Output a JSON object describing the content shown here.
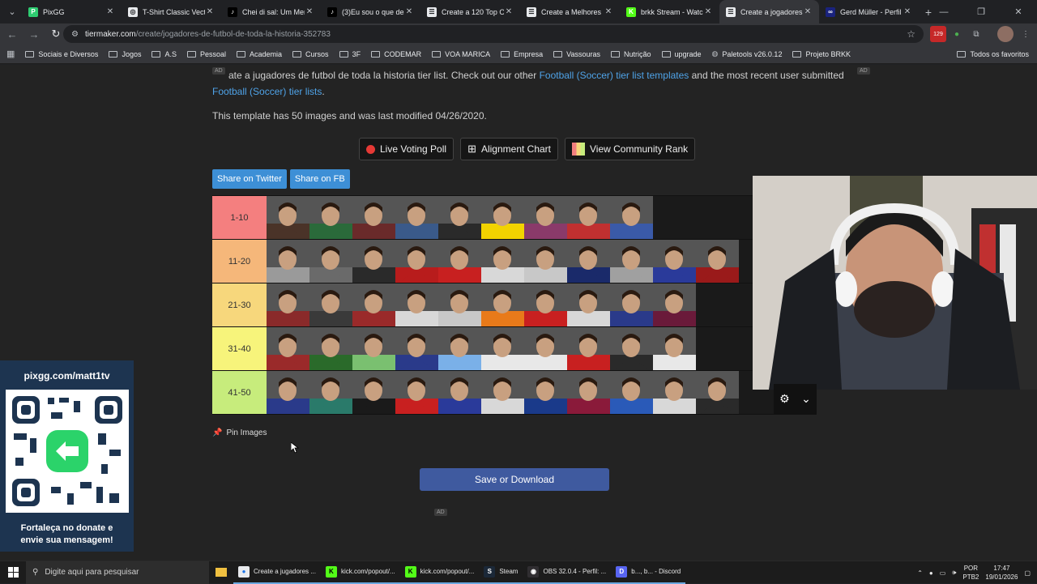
{
  "browser": {
    "tabs": [
      {
        "title": "PixGG",
        "fav_color": "#2ecc71",
        "fav_glyph": "P",
        "active": false
      },
      {
        "title": "T-Shirt Classic Vectra",
        "fav_color": "#e8eaed",
        "fav_glyph": "◎",
        "active": false
      },
      {
        "title": "Chei di sal: Um Meme",
        "fav_color": "#000000",
        "fav_glyph": "♪",
        "active": false
      },
      {
        "title": "(3)Eu sou o que desm",
        "fav_color": "#000000",
        "fav_glyph": "♪",
        "active": false
      },
      {
        "title": "Create a 120 Top On",
        "fav_color": "#e8eaed",
        "fav_glyph": "☰",
        "active": false
      },
      {
        "title": "Create a Melhores lu",
        "fav_color": "#e8eaed",
        "fav_glyph": "☰",
        "active": false
      },
      {
        "title": "brkk Stream - Watch",
        "fav_color": "#53fc18",
        "fav_glyph": "K",
        "active": false
      },
      {
        "title": "Create a jogadores d",
        "fav_color": "#e8eaed",
        "fav_glyph": "☰",
        "active": true
      },
      {
        "title": "Gerd Müller - Perfil d",
        "fav_color": "#1a237e",
        "fav_glyph": "∞",
        "active": false
      }
    ],
    "url_domain": "tiermaker.com",
    "url_path": "/create/jogadores-de-futbol-de-toda-la-historia-352783",
    "ext_badge": "129",
    "bookmarks": [
      "Sociais e Diversos",
      "Jogos",
      "A.S",
      "Pessoal",
      "Academia",
      "Cursos",
      "3F",
      "CODEMAR",
      "VOA MARICA",
      "Empresa",
      "Vassouras",
      "Nutrição",
      "upgrade",
      "Paletools v26.0.12",
      "Projeto BRKK"
    ],
    "bookmarks_all": "Todos os favoritos"
  },
  "page": {
    "ad_label": "AD",
    "intro_prefix": "ate a jugadores de futbol de toda la historia tier list. Check out our other ",
    "intro_link1": "Football (Soccer) tier list templates",
    "intro_mid": " and the most recent user submitted ",
    "intro_link2": "Football (Soccer) tier lists",
    "intro_suffix": ".",
    "modified": "This template has 50 images and was last modified 04/26/2020.",
    "btn_voting": "Live Voting Poll",
    "btn_alignment": "Alignment Chart",
    "btn_community": "View Community Rank",
    "share_twitter": "Share on Twitter",
    "share_fb": "Share on FB",
    "pin_images": "Pin Images",
    "save": "Save or Download"
  },
  "tiers": [
    {
      "label": "1-10",
      "color": "#f47f7f",
      "count": 9,
      "colors": [
        "#4a3328",
        "#2a6a3a",
        "#6a2a2a",
        "#3a5a8a",
        "#2a2a2a",
        "#f2d300",
        "#8a3a6a",
        "#c03030",
        "#3a5aa8"
      ]
    },
    {
      "label": "11-20",
      "color": "#f5b77a",
      "count": 11,
      "colors": [
        "#9a9a9a",
        "#6a6a6a",
        "#2a2a2a",
        "#b81c1c",
        "#c82020",
        "#d8d8d8",
        "#c8c8c8",
        "#1a2a6a",
        "#a0a0a0",
        "#2a3a9a",
        "#9a1a1a"
      ]
    },
    {
      "label": "21-30",
      "color": "#f7d77c",
      "count": 10,
      "colors": [
        "#8a2a2a",
        "#3a3a3a",
        "#9a2a2a",
        "#d8d8d8",
        "#c8c8c8",
        "#e87a1a",
        "#c82020",
        "#d8d8d8",
        "#2a3a8a",
        "#6a1a3a"
      ]
    },
    {
      "label": "31-40",
      "color": "#f7f47b",
      "count": 10,
      "colors": [
        "#9a2a2a",
        "#2a6a2a",
        "#7ac070",
        "#2a3a8a",
        "#7ab0e8",
        "#e8e8e8",
        "#e8e8e8",
        "#c82020",
        "#2a2a2a",
        "#e8e8e8"
      ]
    },
    {
      "label": "41-50",
      "color": "#c7ec7c",
      "count": 11,
      "colors": [
        "#2a3a8a",
        "#2a7a6a",
        "#1a1a1a",
        "#c82020",
        "#2a3a9a",
        "#d8d8d8",
        "#1a3a8a",
        "#8a1a3a",
        "#2a5ab8",
        "#d8d8d8",
        "#2a2a2a"
      ]
    }
  ],
  "overlay": {
    "promo_title": "pixgg.com/matt1tv",
    "promo_text_line1": "Fortaleça no donate e",
    "promo_text_line2": "envie sua mensagem!"
  },
  "taskbar": {
    "search_placeholder": "Digite aqui para pesquisar",
    "items": [
      {
        "label": "Create a jugadores ...",
        "icon_color": "#e8eaed",
        "glyph": "●"
      },
      {
        "label": "kick.com/popout/...",
        "icon_color": "#53fc18",
        "glyph": "K"
      },
      {
        "label": "kick.com/popout/...",
        "icon_color": "#53fc18",
        "glyph": "K"
      },
      {
        "label": "Steam",
        "icon_color": "#1b2838",
        "glyph": "S"
      },
      {
        "label": "OBS 32.0.4 - Perfil: ...",
        "icon_color": "#302e31",
        "glyph": "◉"
      },
      {
        "label": "b..., b... - Discord",
        "icon_color": "#5865f2",
        "glyph": "D"
      }
    ],
    "lang_line1": "POR",
    "lang_line2": "PTB2",
    "time": "17:47",
    "date": "19/01/2026"
  }
}
